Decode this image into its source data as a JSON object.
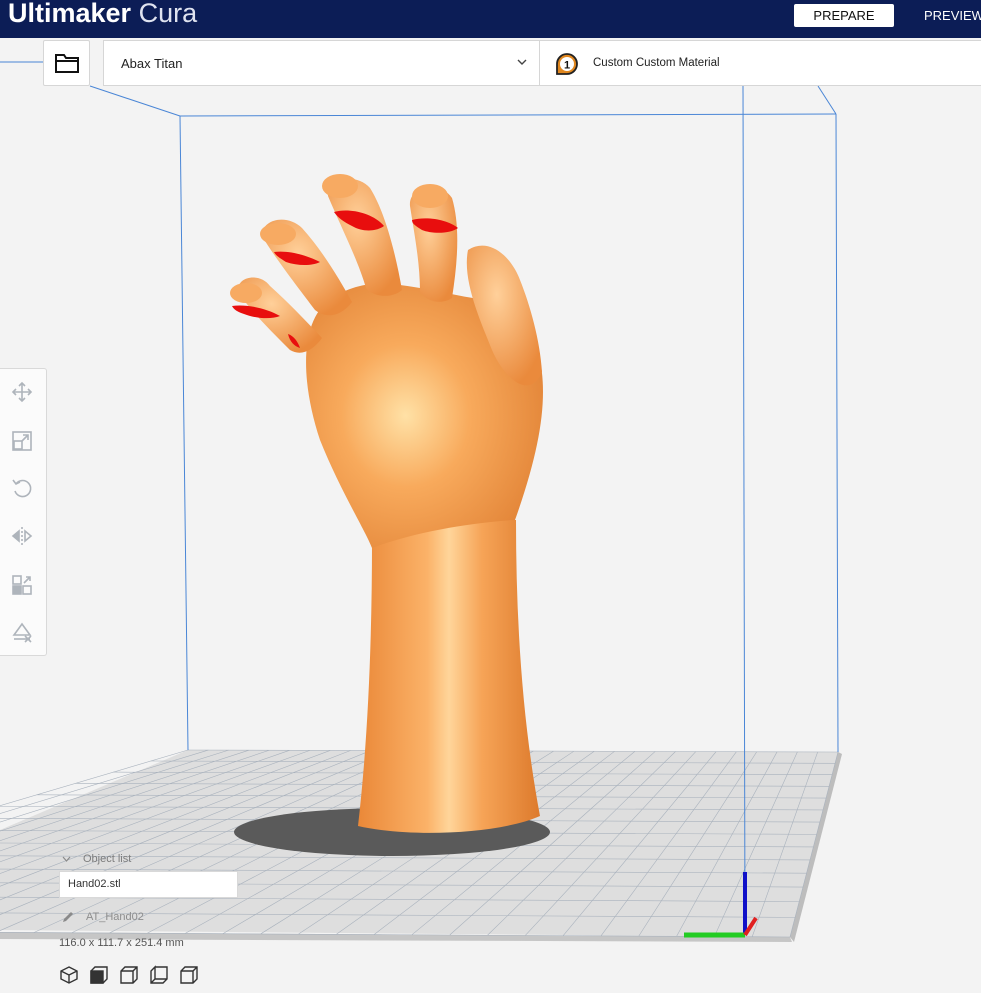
{
  "app": {
    "brand_bold": "Ultimaker",
    "brand_light": "Cura"
  },
  "stages": {
    "prepare": "PREPARE",
    "preview": "PREVIEW"
  },
  "printer": {
    "name": "Abax Titan"
  },
  "material": {
    "extruder_number": "1",
    "name": "Custom Custom Material"
  },
  "toolbar": {
    "tools": [
      {
        "name": "move-tool",
        "icon": "move-icon"
      },
      {
        "name": "scale-tool",
        "icon": "scale-icon"
      },
      {
        "name": "rotate-tool",
        "icon": "rotate-icon"
      },
      {
        "name": "mirror-tool",
        "icon": "mirror-icon"
      },
      {
        "name": "per-model-settings-tool",
        "icon": "per-model-settings-icon"
      },
      {
        "name": "support-blocker-tool",
        "icon": "support-blocker-icon"
      }
    ]
  },
  "object_list": {
    "header": "Object list",
    "items": [
      "Hand02.stl"
    ]
  },
  "selected_object": {
    "name": "AT_Hand02",
    "dimensions": "116.0 x 111.7 x 251.4 mm"
  },
  "view_buttons": [
    "3d-view",
    "front-view",
    "top-view",
    "left-view",
    "right-view"
  ],
  "colors": {
    "header": "#0c1d56",
    "model": "#f59a48",
    "overhang": "#e80e0e",
    "build_volume": "#3b7fd8",
    "axis_x": "#e02020",
    "axis_y": "#22cc22",
    "axis_z": "#1010c8"
  }
}
